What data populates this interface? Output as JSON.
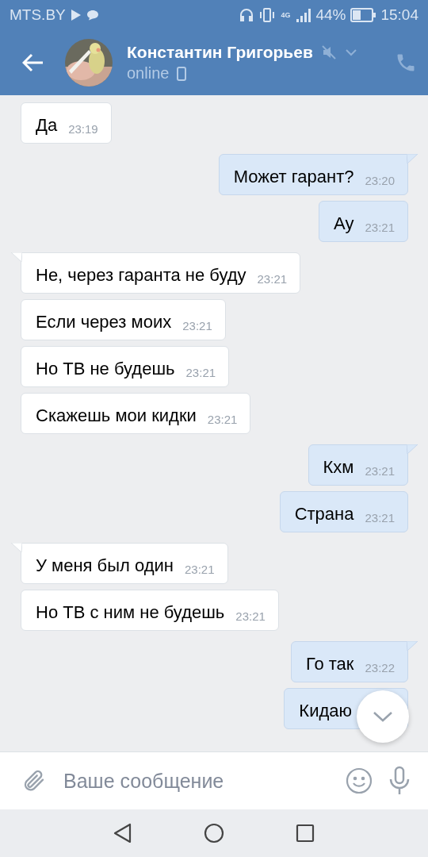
{
  "status_bar": {
    "carrier": "MTS.BY",
    "network": "4G",
    "battery": "44%",
    "time": "15:04"
  },
  "header": {
    "name": "Константин Григорьев",
    "status": "online",
    "muted": true
  },
  "messages": [
    {
      "out": false,
      "tail": false,
      "text": "Да",
      "time": "23:19"
    },
    {
      "out": true,
      "tail": true,
      "text": "Может гарант?",
      "time": "23:20"
    },
    {
      "out": true,
      "tail": false,
      "text": "Ау",
      "time": "23:21"
    },
    {
      "out": false,
      "tail": true,
      "text": "Не, через гаранта не буду",
      "time": "23:21"
    },
    {
      "out": false,
      "tail": false,
      "text": "Если через моих",
      "time": "23:21"
    },
    {
      "out": false,
      "tail": false,
      "text": "Но ТВ не будешь",
      "time": "23:21"
    },
    {
      "out": false,
      "tail": false,
      "text": "Скажешь мои кидки",
      "time": "23:21"
    },
    {
      "out": true,
      "tail": true,
      "text": "Кхм",
      "time": "23:21"
    },
    {
      "out": true,
      "tail": false,
      "text": "Страна",
      "time": "23:21"
    },
    {
      "out": false,
      "tail": true,
      "text": "У меня был один",
      "time": "23:21"
    },
    {
      "out": false,
      "tail": false,
      "text": "Но ТВ с ним не будешь",
      "time": "23:21"
    },
    {
      "out": true,
      "tail": true,
      "text": "Го так",
      "time": "23:22"
    },
    {
      "out": true,
      "tail": false,
      "text": "Кидаю"
    }
  ],
  "composer": {
    "placeholder": "Ваше сообщение"
  }
}
